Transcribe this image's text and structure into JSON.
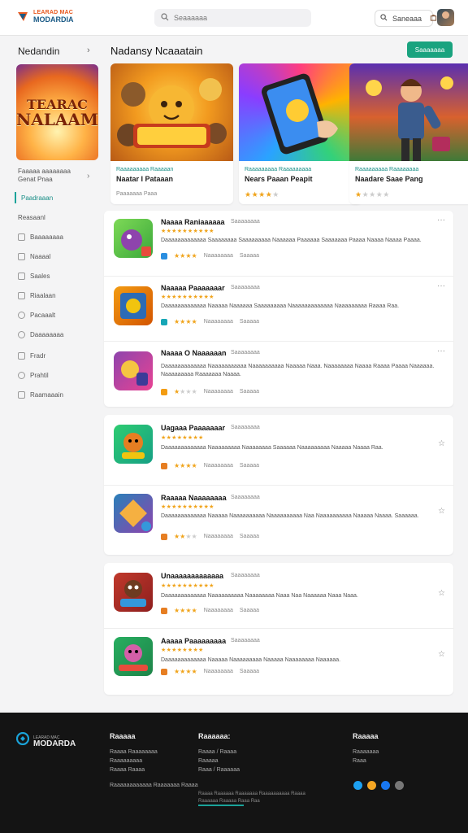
{
  "header": {
    "logo_line1": "LEARAD MAC",
    "logo_line2": "MODARDIA",
    "search_placeholder": "Seaaaaaa",
    "search_button": "Saneaaa"
  },
  "sidebar": {
    "title": "Nedandin",
    "sub_line1": "Faaaaa aaaaaaaa",
    "sub_line2": "Genat Pnaa",
    "banner_line1": "TEARAC",
    "banner_line2": "NALAAM",
    "items": [
      {
        "label": "Paadraaan",
        "active": true
      },
      {
        "label": "Reasaanl",
        "active": false
      },
      {
        "label": "Baaaaaaaa",
        "active": false
      },
      {
        "label": "Naaaal",
        "active": false
      },
      {
        "label": "Saales",
        "active": false
      },
      {
        "label": "Riaalaan",
        "active": false
      },
      {
        "label": "Pacaaalt",
        "active": false
      },
      {
        "label": "Daaaaaaaa",
        "active": false
      },
      {
        "label": "Fradr",
        "active": false
      },
      {
        "label": "Prahtil",
        "active": false
      },
      {
        "label": "Raamaaain",
        "active": false
      }
    ]
  },
  "main": {
    "title": "Nadansy Ncaaatain",
    "button": "Saaaaaaa"
  },
  "featured": [
    {
      "category": "Raaaaaaaaa Raaaaan",
      "name": "Naatar I Pataaan",
      "tag": "Paaaaaaa Paaa"
    },
    {
      "category": "Raaaaaaaaa Raaaaaaaaa",
      "name": "Nears Paaan Peapit",
      "stars": 4
    },
    {
      "category": "Raaaaaaaaa Raaaaaaaa",
      "name": "Naadare Saae Pang",
      "stars": 1
    }
  ],
  "list_groups": [
    [
      {
        "title": "Naaaa Raniaaaaaa",
        "sub": "Saaaaaaaa",
        "desc": "Daaaaaaaaaaaaa Saaaaaaaa Saaaaaaaaa Naaaaaa Paaaaaa Saaaaaaa Paaaa Naaaa Naaaa Paaaa.",
        "stars": 4,
        "meta1": "Naaaaaaaa",
        "meta2": "Saaaaa"
      },
      {
        "title": "Naaaaa Paaaaaaar",
        "sub": "Saaaaaaaa",
        "desc": "Daaaaaaaaaaaaa Naaaaa Naaaaaa Saaaaaaaaa Naaaaaaaaaaaaa Naaaaaaaaa Raaaa Raa.",
        "stars": 4,
        "meta1": "Naaaaaaaa",
        "meta2": "Saaaaa"
      },
      {
        "title": "Naaaa O Naaaaaan",
        "sub": "Saaaaaaaa",
        "desc": "Daaaaaaaaaaaaa Naaaaaaaaaaa Naaaaaaaaaa Naaaaa Naaa. Naaaaaaaa Naaaa Raaaa Paaaa Naaaaaa. Naaaaaaaaa Raaaaaaa Naaaa.",
        "stars": 1,
        "meta1": "Naaaaaaaa",
        "meta2": "Saaaaa"
      }
    ],
    [
      {
        "title": "Uagaaa Paaaaaaar",
        "sub": "Saaaaaaaa",
        "desc": "Daaaaaaaaaaaaa Naaaaaaaaa Naaaaaaaa Saaaaaa Naaaaaaaaa Naaaaa Naaaa Raa.",
        "stars": 4,
        "meta1": "Naaaaaaaa",
        "meta2": "Saaaaa"
      },
      {
        "title": "Raaaaa Naaaaaaaa",
        "sub": "Saaaaaaaa",
        "desc": "Daaaaaaaaaaaaa Naaaaa Naaaaaaaaaa Naaaaaaaaaa Naa Naaaaaaaaaa Naaaaa Naaaa. Saaaaaa.",
        "stars": 2,
        "meta1": "Naaaaaaaa",
        "meta2": "Saaaaa"
      }
    ],
    [
      {
        "title": "Unaaaaaaaaaaaaa",
        "sub": "Saaaaaaaa",
        "desc": "Daaaaaaaaaaaaa Naaaaaaaaaa Naaaaaaaa Naaa Naa Naaaaaa Naaa Naaa.",
        "stars": 4,
        "meta1": "Naaaaaaaa",
        "meta2": "Saaaaa"
      },
      {
        "title": "Aaaaa Paaaaaaaaa",
        "sub": "Saaaaaaaa",
        "desc": "Daaaaaaaaaaaaa Naaaaa Naaaaaaaaa Naaaaa Naaaaaaaa Naaaaaa.",
        "stars": 4,
        "meta1": "Naaaaaaaa",
        "meta2": "Saaaaa"
      }
    ]
  ],
  "footer": {
    "logo_small": "LEARAD MAC",
    "logo_big": "MODARDA",
    "col1_heading": "Raaaaa",
    "col1_links": [
      "Raaaa Raaaaaaaa",
      "Raaaaaaaaa",
      "Raaaa Raaaa"
    ],
    "col2_heading": "Raaaaaa:",
    "col2_links": [
      "Raaaa / Raaaa",
      "Raaaaa",
      "Raaa / Raaaaaa"
    ],
    "col3_heading": "Raaaaa",
    "col3_links": [
      "Raaaaaaa",
      "Raaa"
    ],
    "wide_link": "Raaaaaaaaaaaa Raaaaaaa Raaaa",
    "copyright_line1": "Raaaa Raaaaaa Raaaaaaa Raaaaaaaaaa Raaaa",
    "copyright_line2": "Raaaaaa Raaaaa Raaa Raa"
  }
}
